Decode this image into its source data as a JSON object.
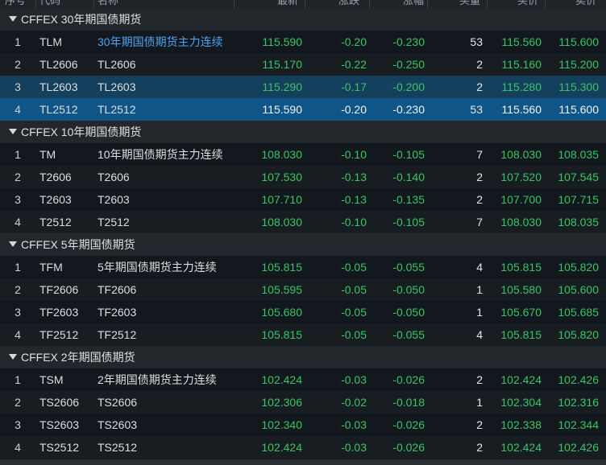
{
  "header": {
    "columns": [
      "序号",
      "代码",
      "名称",
      "最新",
      "涨跌",
      "涨幅",
      "买量",
      "买价",
      "卖价"
    ]
  },
  "groups": [
    {
      "title": "CFFEX 30年期国债期货",
      "rows": [
        {
          "idx": "1",
          "code": "TLM",
          "name": "30年期国债期货主力连续",
          "last": "115.590",
          "chg": "-0.20",
          "pct": "-0.230",
          "vol": "53",
          "bid": "115.560",
          "ask": "115.600"
        },
        {
          "idx": "2",
          "code": "TL2606",
          "name": "TL2606",
          "last": "115.170",
          "chg": "-0.22",
          "pct": "-0.250",
          "vol": "2",
          "bid": "115.160",
          "ask": "115.200"
        },
        {
          "idx": "3",
          "code": "TL2603",
          "name": "TL2603",
          "last": "115.290",
          "chg": "-0.17",
          "pct": "-0.200",
          "vol": "2",
          "bid": "115.280",
          "ask": "115.300"
        },
        {
          "idx": "4",
          "code": "TL2512",
          "name": "TL2512",
          "last": "115.590",
          "chg": "-0.20",
          "pct": "-0.230",
          "vol": "53",
          "bid": "115.560",
          "ask": "115.600"
        }
      ]
    },
    {
      "title": "CFFEX 10年期国债期货",
      "rows": [
        {
          "idx": "1",
          "code": "TM",
          "name": "10年期国债期货主力连续",
          "last": "108.030",
          "chg": "-0.10",
          "pct": "-0.105",
          "vol": "7",
          "bid": "108.030",
          "ask": "108.035"
        },
        {
          "idx": "2",
          "code": "T2606",
          "name": "T2606",
          "last": "107.530",
          "chg": "-0.13",
          "pct": "-0.140",
          "vol": "2",
          "bid": "107.520",
          "ask": "107.545"
        },
        {
          "idx": "3",
          "code": "T2603",
          "name": "T2603",
          "last": "107.710",
          "chg": "-0.13",
          "pct": "-0.135",
          "vol": "2",
          "bid": "107.700",
          "ask": "107.715"
        },
        {
          "idx": "4",
          "code": "T2512",
          "name": "T2512",
          "last": "108.030",
          "chg": "-0.10",
          "pct": "-0.105",
          "vol": "7",
          "bid": "108.030",
          "ask": "108.035"
        }
      ]
    },
    {
      "title": "CFFEX 5年期国债期货",
      "rows": [
        {
          "idx": "1",
          "code": "TFM",
          "name": "5年期国债期货主力连续",
          "last": "105.815",
          "chg": "-0.05",
          "pct": "-0.055",
          "vol": "4",
          "bid": "105.815",
          "ask": "105.820"
        },
        {
          "idx": "2",
          "code": "TF2606",
          "name": "TF2606",
          "last": "105.595",
          "chg": "-0.05",
          "pct": "-0.050",
          "vol": "1",
          "bid": "105.580",
          "ask": "105.600"
        },
        {
          "idx": "3",
          "code": "TF2603",
          "name": "TF2603",
          "last": "105.680",
          "chg": "-0.05",
          "pct": "-0.050",
          "vol": "1",
          "bid": "105.670",
          "ask": "105.685"
        },
        {
          "idx": "4",
          "code": "TF2512",
          "name": "TF2512",
          "last": "105.815",
          "chg": "-0.05",
          "pct": "-0.055",
          "vol": "4",
          "bid": "105.815",
          "ask": "105.820"
        }
      ]
    },
    {
      "title": "CFFEX 2年期国债期货",
      "rows": [
        {
          "idx": "1",
          "code": "TSM",
          "name": "2年期国债期货主力连续",
          "last": "102.424",
          "chg": "-0.03",
          "pct": "-0.026",
          "vol": "2",
          "bid": "102.424",
          "ask": "102.426"
        },
        {
          "idx": "2",
          "code": "TS2606",
          "name": "TS2606",
          "last": "102.306",
          "chg": "-0.02",
          "pct": "-0.018",
          "vol": "1",
          "bid": "102.304",
          "ask": "102.316"
        },
        {
          "idx": "3",
          "code": "TS2603",
          "name": "TS2603",
          "last": "102.340",
          "chg": "-0.03",
          "pct": "-0.026",
          "vol": "2",
          "bid": "102.338",
          "ask": "102.344"
        },
        {
          "idx": "4",
          "code": "TS2512",
          "name": "TS2512",
          "last": "102.424",
          "chg": "-0.03",
          "pct": "-0.026",
          "vol": "2",
          "bid": "102.424",
          "ask": "102.426"
        }
      ]
    }
  ],
  "colors": {
    "price_down": "#39c565",
    "link": "#4da3f0",
    "selected_row": "#0f5587",
    "hover_row": "#143f5d"
  }
}
